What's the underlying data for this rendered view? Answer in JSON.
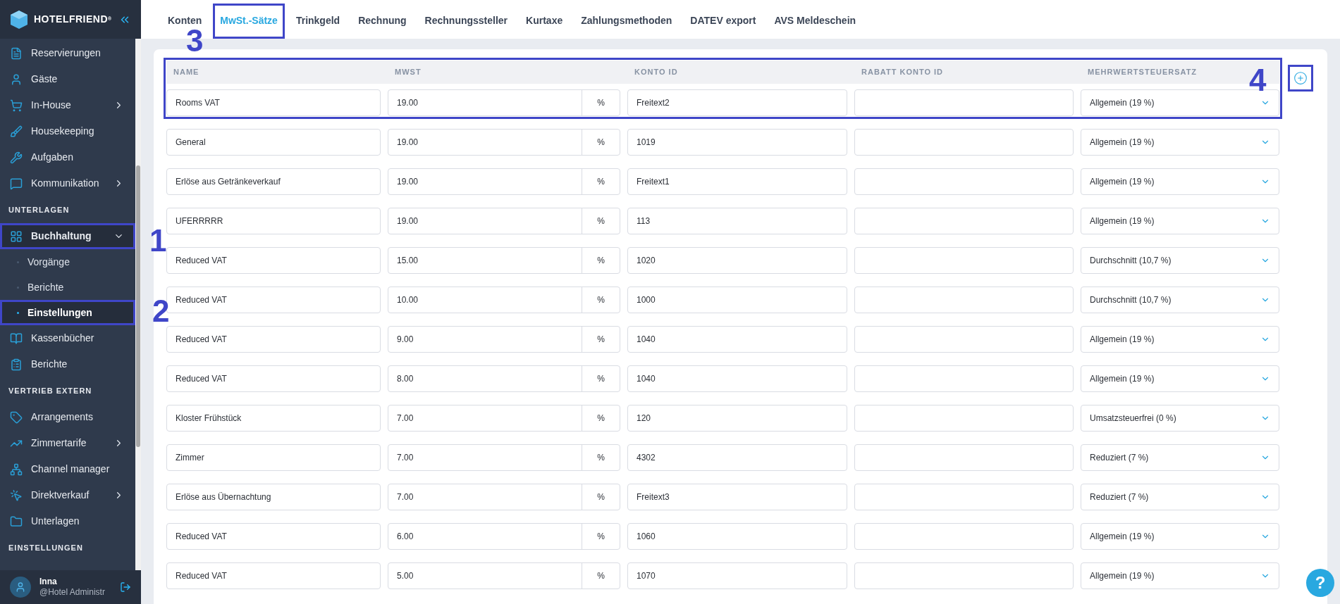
{
  "logo": {
    "text": "HOTELFRIEND",
    "trademark": "®"
  },
  "sidebar": {
    "items": [
      {
        "kind": "item",
        "label": "Reservierungen",
        "has_submenu": false,
        "expanded": false
      },
      {
        "kind": "item",
        "label": "Gäste",
        "has_submenu": false,
        "expanded": false
      },
      {
        "kind": "item",
        "label": "In-House",
        "has_submenu": true,
        "expanded": false
      },
      {
        "kind": "item",
        "label": "Housekeeping",
        "has_submenu": false,
        "expanded": false
      },
      {
        "kind": "item",
        "label": "Aufgaben",
        "has_submenu": false,
        "expanded": false
      },
      {
        "kind": "item",
        "label": "Kommunikation",
        "has_submenu": true,
        "expanded": false
      },
      {
        "kind": "section",
        "label": "UNTERLAGEN"
      },
      {
        "kind": "item",
        "label": "Buchhaltung",
        "has_submenu": true,
        "expanded": true,
        "annotation": "1"
      },
      {
        "kind": "subitem",
        "label": "Vorgänge",
        "selected": false
      },
      {
        "kind": "subitem",
        "label": "Berichte",
        "selected": false
      },
      {
        "kind": "subitem",
        "label": "Einstellungen",
        "selected": true,
        "annotation": "2"
      },
      {
        "kind": "item",
        "label": "Kassenbücher",
        "has_submenu": false,
        "expanded": false
      },
      {
        "kind": "item",
        "label": "Berichte",
        "has_submenu": false,
        "expanded": false
      },
      {
        "kind": "section",
        "label": "VERTRIEB EXTERN"
      },
      {
        "kind": "item",
        "label": "Arrangements",
        "has_submenu": false,
        "expanded": false
      },
      {
        "kind": "item",
        "label": "Zimmertarife",
        "has_submenu": true,
        "expanded": false
      },
      {
        "kind": "item",
        "label": "Channel manager",
        "has_submenu": false,
        "expanded": false
      },
      {
        "kind": "item",
        "label": "Direktverkauf",
        "has_submenu": true,
        "expanded": false
      },
      {
        "kind": "item",
        "label": "Unterlagen",
        "has_submenu": false,
        "expanded": false
      },
      {
        "kind": "section",
        "label": "EINSTELLUNGEN"
      }
    ],
    "user": {
      "name": "Inna",
      "role": "@Hotel Administr"
    }
  },
  "tabs": [
    {
      "label": "Konten",
      "selected": false
    },
    {
      "label": "MwSt.-Sätze",
      "selected": true,
      "annotation": "3"
    },
    {
      "label": "Trinkgeld",
      "selected": false
    },
    {
      "label": "Rechnung",
      "selected": false
    },
    {
      "label": "Rechnungssteller",
      "selected": false
    },
    {
      "label": "Kurtaxe",
      "selected": false
    },
    {
      "label": "Zahlungsmethoden",
      "selected": false
    },
    {
      "label": "DATEV export",
      "selected": false
    },
    {
      "label": "AVS Meldeschein",
      "selected": false
    }
  ],
  "table": {
    "annotation": "4",
    "columns": [
      "NAME",
      "MWST",
      "KONTO ID",
      "RABATT KONTO ID",
      "MEHRWERTSTEUERSATZ"
    ],
    "rows": [
      {
        "name": "Rooms VAT",
        "mwst": "19.00",
        "unit": "%",
        "konto_id": "Freitext2",
        "rate": "Allgemein (19 %)"
      },
      {
        "name": "General",
        "mwst": "19.00",
        "unit": "%",
        "konto_id": "1019",
        "rate": "Allgemein (19 %)"
      },
      {
        "name": "Erlöse aus Getränkeverkauf",
        "mwst": "19.00",
        "unit": "%",
        "konto_id": "Freitext1",
        "rate": "Allgemein (19 %)"
      },
      {
        "name": "UFERRRRR",
        "mwst": "19.00",
        "unit": "%",
        "konto_id": "113",
        "rate": "Allgemein (19 %)"
      },
      {
        "name": "Reduced VAT",
        "mwst": "15.00",
        "unit": "%",
        "konto_id": "1020",
        "rate": "Durchschnitt (10,7 %)"
      },
      {
        "name": "Reduced VAT",
        "mwst": "10.00",
        "unit": "%",
        "konto_id": "1000",
        "rate": "Durchschnitt (10,7 %)"
      },
      {
        "name": "Reduced VAT",
        "mwst": "9.00",
        "unit": "%",
        "konto_id": "1040",
        "rate": "Allgemein (19 %)"
      },
      {
        "name": "Reduced VAT",
        "mwst": "8.00",
        "unit": "%",
        "konto_id": "1040",
        "rate": "Allgemein (19 %)"
      },
      {
        "name": "Kloster Frühstück",
        "mwst": "7.00",
        "unit": "%",
        "konto_id": "120",
        "rate": "Umsatzsteuerfrei (0 %)"
      },
      {
        "name": "Zimmer",
        "mwst": "7.00",
        "unit": "%",
        "konto_id": "4302",
        "rate": "Reduziert (7 %)"
      },
      {
        "name": "Erlöse aus Übernachtung",
        "mwst": "7.00",
        "unit": "%",
        "konto_id": "Freitext3",
        "rate": "Reduziert (7 %)"
      },
      {
        "name": "Reduced VAT",
        "mwst": "6.00",
        "unit": "%",
        "konto_id": "1060",
        "rate": "Allgemein (19 %)"
      },
      {
        "name": "Reduced VAT",
        "mwst": "5.00",
        "unit": "%",
        "konto_id": "1070",
        "rate": "Allgemein (19 %)"
      }
    ]
  },
  "add_button": {
    "annotated": true
  },
  "help_button": {
    "label": "?"
  }
}
